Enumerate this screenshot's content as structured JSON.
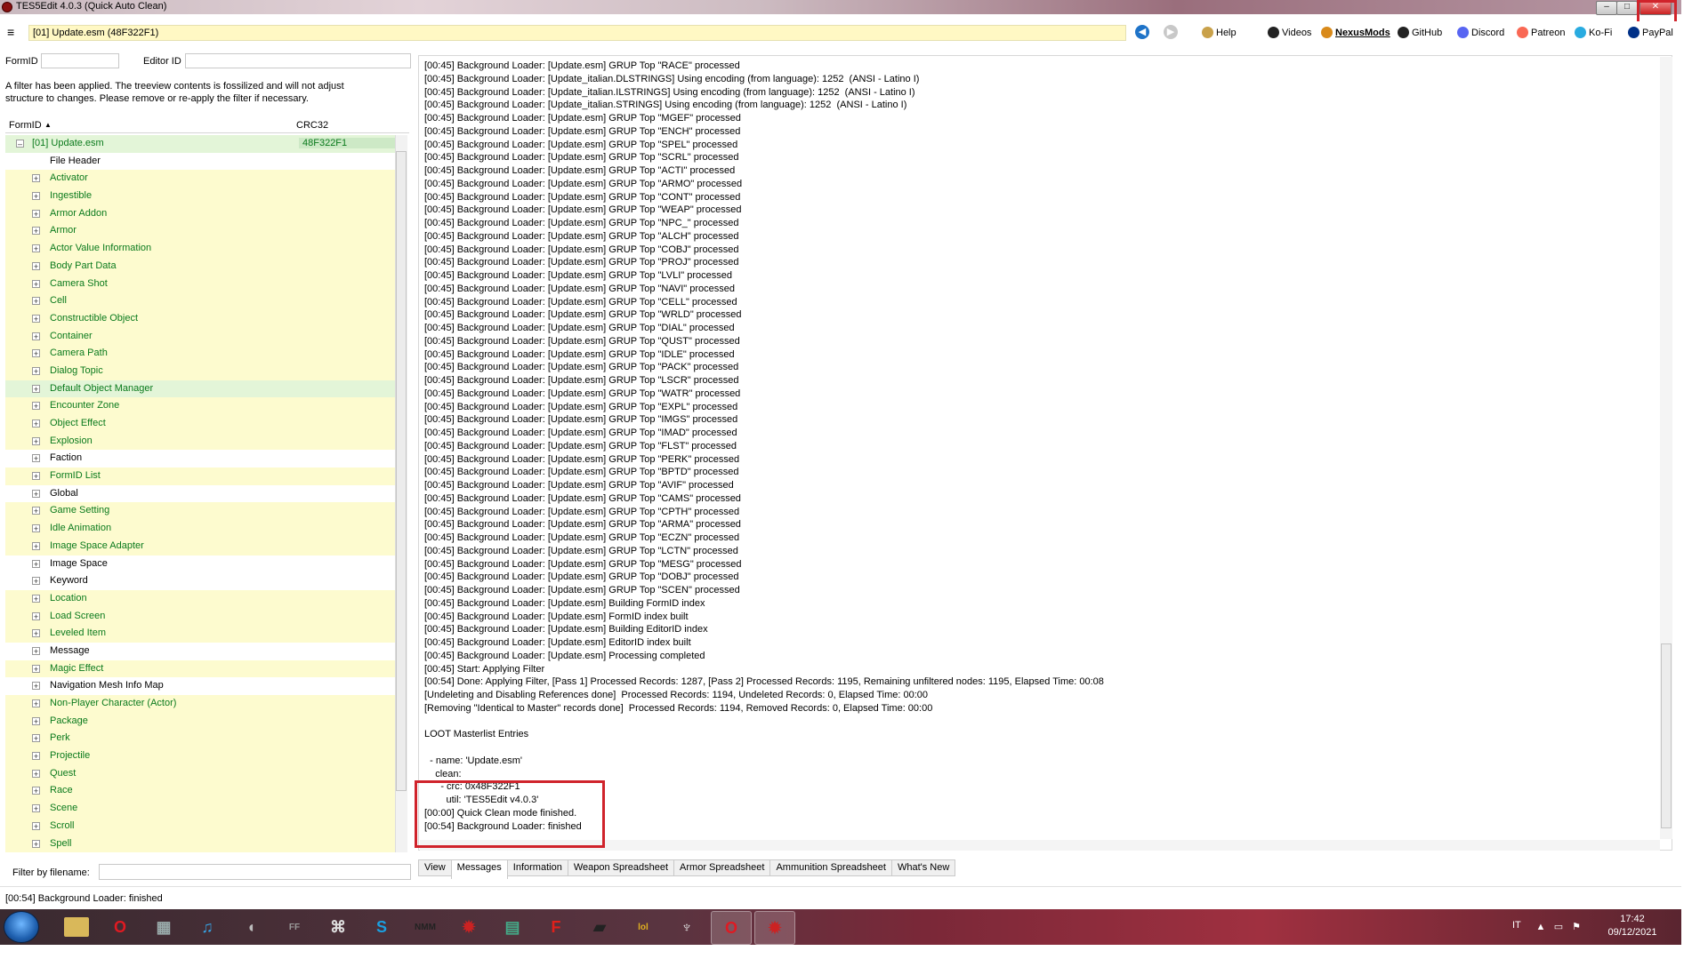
{
  "window": {
    "title": "TES5Edit 4.0.3 (Quick Auto Clean)",
    "minimize": "–",
    "maximize": "□",
    "close": "✕"
  },
  "toolbar": {
    "menu_glyph": "≡",
    "file_path": "[01] Update.esm (48F322F1)",
    "links": [
      {
        "label": "Help",
        "icon": "book-icon"
      },
      {
        "label": "Videos",
        "icon": "film-icon"
      },
      {
        "label": "NexusMods",
        "icon": "nexus-icon"
      },
      {
        "label": "GitHub",
        "icon": "github-icon"
      },
      {
        "label": "Discord",
        "icon": "discord-icon"
      },
      {
        "label": "Patreon",
        "icon": "patreon-icon"
      },
      {
        "label": "Ko-Fi",
        "icon": "kofi-icon"
      },
      {
        "label": "PayPal",
        "icon": "paypal-icon"
      }
    ]
  },
  "left": {
    "formid_label": "FormID",
    "editorid_label": "Editor ID",
    "filter_note": "A filter has been applied. The treeview contents is fossilized and will not adjust structure to changes.  Please remove or re-apply the filter if necessary.",
    "col_formid": "FormID",
    "col_crc": "CRC32",
    "root": {
      "name": "[01] Update.esm",
      "crc": "48F322F1"
    },
    "items": [
      {
        "name": "File Header",
        "color": "black",
        "bg": "white",
        "expand": false
      },
      {
        "name": "Activator",
        "color": "green",
        "bg": "yellow",
        "expand": true
      },
      {
        "name": "Ingestible",
        "color": "green",
        "bg": "yellow",
        "expand": true
      },
      {
        "name": "Armor Addon",
        "color": "green",
        "bg": "yellow",
        "expand": true
      },
      {
        "name": "Armor",
        "color": "green",
        "bg": "yellow",
        "expand": true
      },
      {
        "name": "Actor Value Information",
        "color": "green",
        "bg": "yellow",
        "expand": true
      },
      {
        "name": "Body Part Data",
        "color": "green",
        "bg": "yellow",
        "expand": true
      },
      {
        "name": "Camera Shot",
        "color": "green",
        "bg": "yellow",
        "expand": true
      },
      {
        "name": "Cell",
        "color": "green",
        "bg": "yellow",
        "expand": true
      },
      {
        "name": "Constructible Object",
        "color": "green",
        "bg": "yellow",
        "expand": true
      },
      {
        "name": "Container",
        "color": "green",
        "bg": "yellow",
        "expand": true
      },
      {
        "name": "Camera Path",
        "color": "green",
        "bg": "yellow",
        "expand": true
      },
      {
        "name": "Dialog Topic",
        "color": "green",
        "bg": "yellow",
        "expand": true
      },
      {
        "name": "Default Object Manager",
        "color": "green",
        "bg": "green",
        "expand": true
      },
      {
        "name": "Encounter Zone",
        "color": "green",
        "bg": "yellow",
        "expand": true
      },
      {
        "name": "Object Effect",
        "color": "green",
        "bg": "yellow",
        "expand": true
      },
      {
        "name": "Explosion",
        "color": "green",
        "bg": "yellow",
        "expand": true
      },
      {
        "name": "Faction",
        "color": "black",
        "bg": "white",
        "expand": true
      },
      {
        "name": "FormID List",
        "color": "green",
        "bg": "yellow",
        "expand": true
      },
      {
        "name": "Global",
        "color": "black",
        "bg": "white",
        "expand": true
      },
      {
        "name": "Game Setting",
        "color": "green",
        "bg": "yellow",
        "expand": true
      },
      {
        "name": "Idle Animation",
        "color": "green",
        "bg": "yellow",
        "expand": true
      },
      {
        "name": "Image Space Adapter",
        "color": "green",
        "bg": "yellow",
        "expand": true
      },
      {
        "name": "Image Space",
        "color": "black",
        "bg": "white",
        "expand": true
      },
      {
        "name": "Keyword",
        "color": "black",
        "bg": "white",
        "expand": true
      },
      {
        "name": "Location",
        "color": "green",
        "bg": "yellow",
        "expand": true
      },
      {
        "name": "Load Screen",
        "color": "green",
        "bg": "yellow",
        "expand": true
      },
      {
        "name": "Leveled Item",
        "color": "green",
        "bg": "yellow",
        "expand": true
      },
      {
        "name": "Message",
        "color": "black",
        "bg": "white",
        "expand": true
      },
      {
        "name": "Magic Effect",
        "color": "green",
        "bg": "yellow",
        "expand": true
      },
      {
        "name": "Navigation Mesh Info Map",
        "color": "black",
        "bg": "white",
        "expand": true
      },
      {
        "name": "Non-Player Character (Actor)",
        "color": "green",
        "bg": "yellow",
        "expand": true
      },
      {
        "name": "Package",
        "color": "green",
        "bg": "yellow",
        "expand": true
      },
      {
        "name": "Perk",
        "color": "green",
        "bg": "yellow",
        "expand": true
      },
      {
        "name": "Projectile",
        "color": "green",
        "bg": "yellow",
        "expand": true
      },
      {
        "name": "Quest",
        "color": "green",
        "bg": "yellow",
        "expand": true
      },
      {
        "name": "Race",
        "color": "green",
        "bg": "yellow",
        "expand": true
      },
      {
        "name": "Scene",
        "color": "green",
        "bg": "yellow",
        "expand": true
      },
      {
        "name": "Scroll",
        "color": "green",
        "bg": "yellow",
        "expand": true
      },
      {
        "name": "Spell",
        "color": "green",
        "bg": "yellow",
        "expand": true
      }
    ],
    "filter_by_filename_label": "Filter by filename:"
  },
  "messages": {
    "lines": [
      "[00:45] Background Loader: [Update.esm] GRUP Top \"RACE\" processed",
      "[00:45] Background Loader: [Update_italian.DLSTRINGS] Using encoding (from language): 1252  (ANSI - Latino I)",
      "[00:45] Background Loader: [Update_italian.ILSTRINGS] Using encoding (from language): 1252  (ANSI - Latino I)",
      "[00:45] Background Loader: [Update_italian.STRINGS] Using encoding (from language): 1252  (ANSI - Latino I)",
      "[00:45] Background Loader: [Update.esm] GRUP Top \"MGEF\" processed",
      "[00:45] Background Loader: [Update.esm] GRUP Top \"ENCH\" processed",
      "[00:45] Background Loader: [Update.esm] GRUP Top \"SPEL\" processed",
      "[00:45] Background Loader: [Update.esm] GRUP Top \"SCRL\" processed",
      "[00:45] Background Loader: [Update.esm] GRUP Top \"ACTI\" processed",
      "[00:45] Background Loader: [Update.esm] GRUP Top \"ARMO\" processed",
      "[00:45] Background Loader: [Update.esm] GRUP Top \"CONT\" processed",
      "[00:45] Background Loader: [Update.esm] GRUP Top \"WEAP\" processed",
      "[00:45] Background Loader: [Update.esm] GRUP Top \"NPC_\" processed",
      "[00:45] Background Loader: [Update.esm] GRUP Top \"ALCH\" processed",
      "[00:45] Background Loader: [Update.esm] GRUP Top \"COBJ\" processed",
      "[00:45] Background Loader: [Update.esm] GRUP Top \"PROJ\" processed",
      "[00:45] Background Loader: [Update.esm] GRUP Top \"LVLI\" processed",
      "[00:45] Background Loader: [Update.esm] GRUP Top \"NAVI\" processed",
      "[00:45] Background Loader: [Update.esm] GRUP Top \"CELL\" processed",
      "[00:45] Background Loader: [Update.esm] GRUP Top \"WRLD\" processed",
      "[00:45] Background Loader: [Update.esm] GRUP Top \"DIAL\" processed",
      "[00:45] Background Loader: [Update.esm] GRUP Top \"QUST\" processed",
      "[00:45] Background Loader: [Update.esm] GRUP Top \"IDLE\" processed",
      "[00:45] Background Loader: [Update.esm] GRUP Top \"PACK\" processed",
      "[00:45] Background Loader: [Update.esm] GRUP Top \"LSCR\" processed",
      "[00:45] Background Loader: [Update.esm] GRUP Top \"WATR\" processed",
      "[00:45] Background Loader: [Update.esm] GRUP Top \"EXPL\" processed",
      "[00:45] Background Loader: [Update.esm] GRUP Top \"IMGS\" processed",
      "[00:45] Background Loader: [Update.esm] GRUP Top \"IMAD\" processed",
      "[00:45] Background Loader: [Update.esm] GRUP Top \"FLST\" processed",
      "[00:45] Background Loader: [Update.esm] GRUP Top \"PERK\" processed",
      "[00:45] Background Loader: [Update.esm] GRUP Top \"BPTD\" processed",
      "[00:45] Background Loader: [Update.esm] GRUP Top \"AVIF\" processed",
      "[00:45] Background Loader: [Update.esm] GRUP Top \"CAMS\" processed",
      "[00:45] Background Loader: [Update.esm] GRUP Top \"CPTH\" processed",
      "[00:45] Background Loader: [Update.esm] GRUP Top \"ARMA\" processed",
      "[00:45] Background Loader: [Update.esm] GRUP Top \"ECZN\" processed",
      "[00:45] Background Loader: [Update.esm] GRUP Top \"LCTN\" processed",
      "[00:45] Background Loader: [Update.esm] GRUP Top \"MESG\" processed",
      "[00:45] Background Loader: [Update.esm] GRUP Top \"DOBJ\" processed",
      "[00:45] Background Loader: [Update.esm] GRUP Top \"SCEN\" processed",
      "[00:45] Background Loader: [Update.esm] Building FormID index",
      "[00:45] Background Loader: [Update.esm] FormID index built",
      "[00:45] Background Loader: [Update.esm] Building EditorID index",
      "[00:45] Background Loader: [Update.esm] EditorID index built",
      "[00:45] Background Loader: [Update.esm] Processing completed",
      "[00:45] Start: Applying Filter",
      "[00:54] Done: Applying Filter, [Pass 1] Processed Records: 1287, [Pass 2] Processed Records: 1195, Remaining unfiltered nodes: 1195, Elapsed Time: 00:08",
      "[Undeleting and Disabling References done]  Processed Records: 1194, Undeleted Records: 0, Elapsed Time: 00:00",
      "[Removing \"Identical to Master\" records done]  Processed Records: 1194, Removed Records: 0, Elapsed Time: 00:00",
      "",
      "LOOT Masterlist Entries",
      "",
      "  - name: 'Update.esm'",
      "    clean:",
      "      - crc: 0x48F322F1",
      "        util: 'TES5Edit v4.0.3'",
      "[00:00] Quick Clean mode finished.",
      "[00:54] Background Loader: finished"
    ]
  },
  "tabs": [
    "View",
    "Messages",
    "Information",
    "Weapon Spreadsheet",
    "Armor Spreadsheet",
    "Ammunition Spreadsheet",
    "What's New"
  ],
  "active_tab": "Messages",
  "status": "[00:54] Background Loader: finished",
  "taskbar": {
    "items": [
      {
        "icon": "folder-icon",
        "glyph": "",
        "color": "#d9b85a"
      },
      {
        "icon": "opera-icon",
        "glyph": "O",
        "color": "#e01a22"
      },
      {
        "icon": "media-center-icon",
        "glyph": "▦",
        "color": "#9aa"
      },
      {
        "icon": "music-icon",
        "glyph": "♫",
        "color": "#37a0e0"
      },
      {
        "icon": "speaker-icon",
        "glyph": "◖",
        "color": "#bbb"
      },
      {
        "icon": "ff-icon",
        "glyph": "FF",
        "color": "#9a9a9a"
      },
      {
        "icon": "app-icon",
        "glyph": "⌘",
        "color": "#ddd"
      },
      {
        "icon": "skype-icon",
        "glyph": "S",
        "color": "#1a9fe0"
      },
      {
        "icon": "nmm-icon",
        "glyph": "NMM",
        "color": "#222"
      },
      {
        "icon": "gear-red-icon",
        "glyph": "✹",
        "color": "#c22"
      },
      {
        "icon": "notepad-icon",
        "glyph": "▤",
        "color": "#4a8"
      },
      {
        "icon": "f-app-icon",
        "glyph": "F",
        "color": "#e0201a"
      },
      {
        "icon": "boot-icon",
        "glyph": "▰",
        "color": "#222"
      },
      {
        "icon": "lol-icon",
        "glyph": "lol",
        "color": "#e0b020"
      },
      {
        "icon": "skyrim-icon",
        "glyph": "♆",
        "color": "#ddd"
      },
      {
        "icon": "opera-active-icon",
        "glyph": "O",
        "color": "#e01a22",
        "active": true
      },
      {
        "icon": "tes5edit-icon",
        "glyph": "✹",
        "color": "#c22",
        "active": true
      }
    ],
    "lang": "IT",
    "time": "17:42",
    "date": "09/12/2021"
  }
}
